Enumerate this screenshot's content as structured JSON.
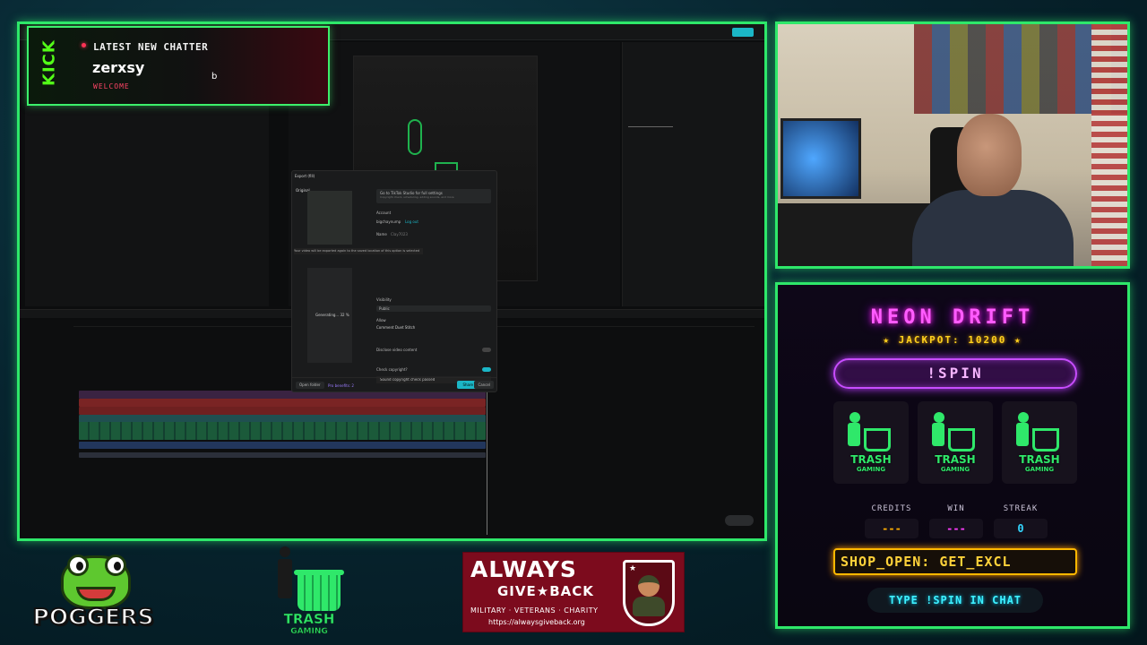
{
  "editor": {
    "export_dialog": {
      "title": "Export (fill)",
      "original_label": "Original",
      "tiktok_heading": "Go to TikTok Studio for full settings",
      "tiktok_sub": "Copyright check, scheduling, adding sounds, and more",
      "account_label": "Account",
      "account_name": "bigchaynump",
      "logout_link": "Log out",
      "name_label": "Name",
      "name_value": "Clay7023",
      "notice": "Your video will be exported again to the saved location of this option is selected",
      "progress_text": "Generating... 32 %",
      "visibility_label": "Visibility",
      "visibility_value": "Public",
      "allow_label": "Allow",
      "allow_options": "Comment   Duet   Stitch",
      "disclose_label": "Disclose video content",
      "copyright_label": "Check copyright?",
      "copyright_result": "Sound copyright check passed",
      "open_folder": "Open folder",
      "benefits": "Pro benefits: 2",
      "share": "Share",
      "cancel": "Cancel"
    }
  },
  "chatter_alert": {
    "platform": "KICK",
    "title": "LATEST NEW CHATTER",
    "username": "zerxsy",
    "subtitle": "WELCOME",
    "extra": "b"
  },
  "game": {
    "title": "NEON DRIFT",
    "jackpot": "★ JACKPOT: 10200 ★",
    "spin_label": "!SPIN",
    "reels": [
      {
        "line1": "TRASH",
        "line2": "GAMING"
      },
      {
        "line1": "TRASH",
        "line2": "GAMING"
      },
      {
        "line1": "TRASH",
        "line2": "GAMING"
      }
    ],
    "stats": {
      "credits_label": "CREDITS",
      "credits_value": "---",
      "win_label": "WIN",
      "win_value": "---",
      "streak_label": "STREAK",
      "streak_value": "0"
    },
    "shop": "SHOP_OPEN: GET_EXCL",
    "hint": "TYPE !SPIN IN CHAT"
  },
  "logos": {
    "poggers": "POGGERS",
    "trash_line1": "TRASH",
    "trash_line2": "GAMING",
    "charity_line1": "ALWAYS",
    "charity_line2": "GIVE★BACK",
    "charity_line3": "MILITARY · VETERANS · CHARITY",
    "charity_url": "https://alwaysgiveback.org"
  },
  "colors": {
    "frame_accent": "#2ee86a",
    "kick_green": "#53fc18",
    "neon_pink": "#ff5cff",
    "jackpot_gold": "#ffd21e",
    "spin_purple": "#c84dff",
    "shop_orange": "#ffb800",
    "hint_cyan": "#3ef0ff",
    "win_pink": "#ff3dff",
    "streak_cyan": "#33d6ff",
    "credits_orange": "#ffae00",
    "charity_red": "#7c0b1d"
  }
}
